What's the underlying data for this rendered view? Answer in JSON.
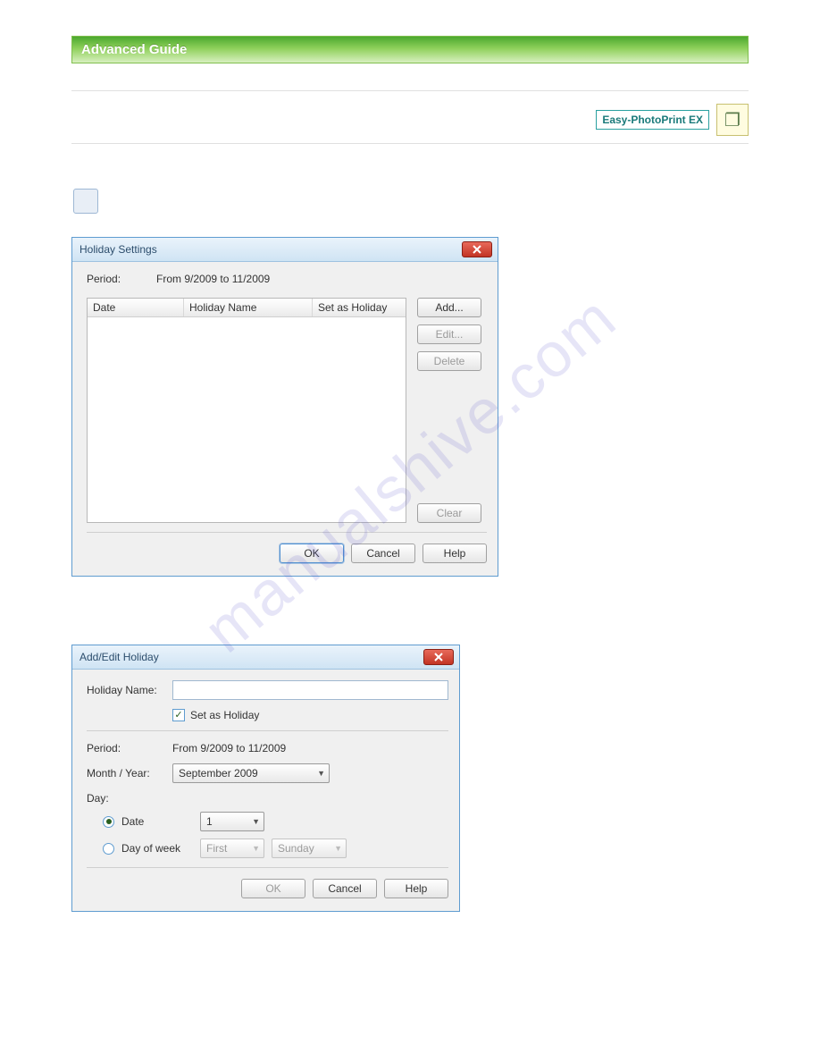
{
  "banner": {
    "title": "Advanced Guide"
  },
  "app_badge": {
    "text": "Easy-PhotoPrint EX"
  },
  "dialog1": {
    "title": "Holiday Settings",
    "period_label": "Period:",
    "period_value": "From 9/2009 to 11/2009",
    "columns": {
      "date": "Date",
      "holiday_name": "Holiday Name",
      "set_as_holiday": "Set as Holiday"
    },
    "buttons": {
      "add": "Add...",
      "edit": "Edit...",
      "delete": "Delete",
      "clear": "Clear",
      "ok": "OK",
      "cancel": "Cancel",
      "help": "Help"
    }
  },
  "dialog2": {
    "title": "Add/Edit Holiday",
    "holiday_name_label": "Holiday Name:",
    "holiday_name_value": "",
    "set_as_holiday": "Set as Holiday",
    "period_label": "Period:",
    "period_value": "From 9/2009 to 11/2009",
    "month_year_label": "Month / Year:",
    "month_year_value": "September 2009",
    "day_label": "Day:",
    "option_date": "Date",
    "date_value": "1",
    "option_dow": "Day of week",
    "dow_ordinal": "First",
    "dow_day": "Sunday",
    "buttons": {
      "ok": "OK",
      "cancel": "Cancel",
      "help": "Help"
    }
  },
  "watermark": "manualshive.com"
}
